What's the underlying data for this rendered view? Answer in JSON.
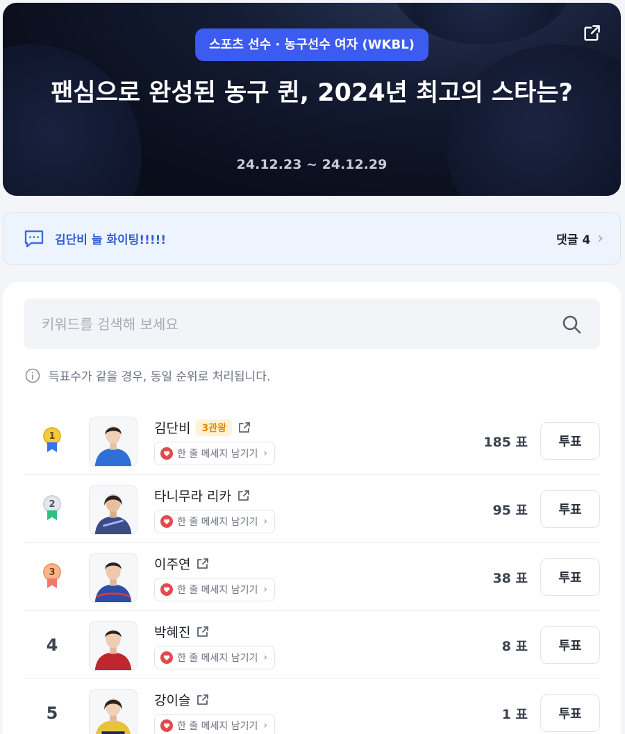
{
  "banner": {
    "category": "스포츠 선수 · 농구선수 여자 (WKBL)",
    "title": "팬심으로 완성된 농구 퀸, 2024년 최고의 스타는?",
    "date": "24.12.23 ~ 24.12.29"
  },
  "comment_bar": {
    "message": "김단비 늘 화이팅!!!!!",
    "count_label": "댓글 4"
  },
  "search": {
    "placeholder": "키워드를 검색해 보세요"
  },
  "notice": "득표수가 같을 경우, 동일 순위로 처리됩니다.",
  "candidates": [
    {
      "rank": "1",
      "name": "김단비",
      "badge": "3관왕",
      "message_label": "한 줄 메세지 남기기",
      "votes": "185 표",
      "vote_label": "투표",
      "jersey_color": "#2f6fd6"
    },
    {
      "rank": "2",
      "name": "타니무라 리카",
      "badge": "",
      "message_label": "한 줄 메세지 남기기",
      "votes": "95 표",
      "vote_label": "투표",
      "jersey_color": "#3c4a86"
    },
    {
      "rank": "3",
      "name": "이주연",
      "badge": "",
      "message_label": "한 줄 메세지 남기기",
      "votes": "38 표",
      "vote_label": "투표",
      "jersey_color": "#2a4fa8"
    },
    {
      "rank": "4",
      "name": "박혜진",
      "badge": "",
      "message_label": "한 줄 메세지 남기기",
      "votes": "8 표",
      "vote_label": "투표",
      "jersey_color": "#c0262b"
    },
    {
      "rank": "5",
      "name": "강이슬",
      "badge": "",
      "message_label": "한 줄 메세지 남기기",
      "votes": "1 표",
      "vote_label": "투표",
      "jersey_color": "#e8c23a"
    }
  ],
  "colors": {
    "accent": "#3c5bf0",
    "comment_text": "#2f5fd0",
    "badge_text": "#e08a00"
  }
}
